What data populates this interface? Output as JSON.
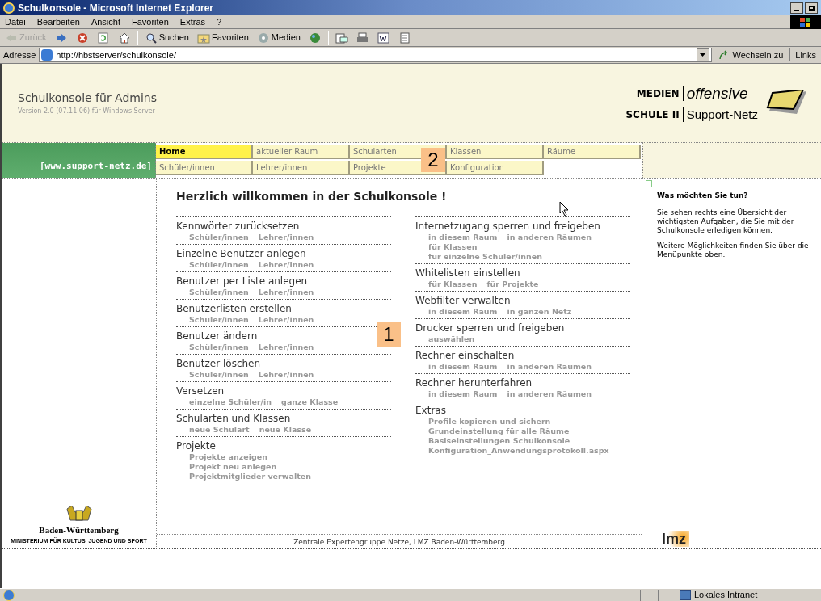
{
  "window": {
    "title": "Schulkonsole - Microsoft Internet Explorer"
  },
  "menu": [
    "Datei",
    "Bearbeiten",
    "Ansicht",
    "Favoriten",
    "Extras",
    "?"
  ],
  "toolbar": [
    {
      "kind": "back",
      "label": "Zurück",
      "disabled": true
    },
    {
      "kind": "forward",
      "disabled": false
    },
    {
      "kind": "stop"
    },
    {
      "kind": "refresh"
    },
    {
      "kind": "home"
    },
    {
      "kind": "sep"
    },
    {
      "kind": "search",
      "label": "Suchen"
    },
    {
      "kind": "favorites",
      "label": "Favoriten"
    },
    {
      "kind": "media",
      "label": "Medien"
    },
    {
      "kind": "history"
    },
    {
      "kind": "sep"
    },
    {
      "kind": "mail"
    },
    {
      "kind": "print"
    },
    {
      "kind": "word"
    },
    {
      "kind": "note"
    }
  ],
  "address": {
    "label": "Adresse",
    "value": "http://hbstserver/schulkonsole/",
    "go": "Wechseln zu",
    "links": "Links"
  },
  "header": {
    "title": "Schulkonsole für Admins",
    "version": "Version 2.0 (07.11.06) für Windows Server",
    "logo_top_left": "MEDIEN",
    "logo_top_right": "offensive",
    "logo_bottom_left": "SCHULE II",
    "logo_bottom_right": "Support-Netz"
  },
  "banner": "[www.support-netz.de]",
  "nav": [
    [
      {
        "label": "Home",
        "selected": true
      },
      {
        "label": "aktueller Raum",
        "selected": false
      },
      {
        "label": "Schularten",
        "selected": false
      },
      {
        "label": "Klassen",
        "selected": false
      },
      {
        "label": "Räume",
        "selected": false
      }
    ],
    [
      {
        "label": "Schüler/innen",
        "selected": false
      },
      {
        "label": "Lehrer/innen",
        "selected": false
      },
      {
        "label": "Projekte",
        "selected": false
      },
      {
        "label": "Konfiguration",
        "selected": false
      }
    ]
  ],
  "welcome": "Herzlich willkommen in der Schulkonsole !",
  "columns": [
    [
      {
        "title": "Kennwörter zurücksetzen",
        "links": [
          [
            "Schüler/innen",
            "Lehrer/innen"
          ]
        ]
      },
      {
        "title": "Einzelne Benutzer anlegen",
        "links": [
          [
            "Schüler/innen",
            "Lehrer/innen"
          ]
        ]
      },
      {
        "title": "Benutzer per Liste anlegen",
        "links": [
          [
            "Schüler/innen",
            "Lehrer/innen"
          ]
        ]
      },
      {
        "title": "Benutzerlisten erstellen",
        "links": [
          [
            "Schüler/innen",
            "Lehrer/innen"
          ]
        ]
      },
      {
        "title": "Benutzer ändern",
        "links": [
          [
            "Schüler/innen",
            "Lehrer/innen"
          ]
        ]
      },
      {
        "title": "Benutzer löschen",
        "links": [
          [
            "Schüler/innen",
            "Lehrer/innen"
          ]
        ]
      },
      {
        "title": "Versetzen",
        "links": [
          [
            "einzelne Schüler/in",
            "ganze Klasse"
          ]
        ]
      },
      {
        "title": "Schularten und Klassen",
        "links": [
          [
            "neue Schulart",
            "neue Klasse"
          ]
        ]
      },
      {
        "title": "Projekte",
        "links": [
          [
            "Projekte anzeigen"
          ],
          [
            "Projekt neu anlegen"
          ],
          [
            "Projektmitglieder verwalten"
          ]
        ]
      }
    ],
    [
      {
        "title": "Internetzugang sperren und freigeben",
        "links": [
          [
            "in diesem Raum",
            "in anderen Räumen"
          ],
          [
            "für Klassen"
          ],
          [
            "für einzelne Schüler/innen"
          ]
        ]
      },
      {
        "title": "Whitelisten einstellen",
        "links": [
          [
            "für Klassen",
            "für Projekte"
          ]
        ]
      },
      {
        "title": "Webfilter verwalten",
        "links": [
          [
            "in diesem Raum",
            "in ganzen Netz"
          ]
        ]
      },
      {
        "title": "Drucker sperren und freigeben",
        "links": [
          [
            "auswählen"
          ]
        ]
      },
      {
        "title": "Rechner einschalten",
        "links": [
          [
            "in diesem Raum",
            "in anderen Räumen"
          ]
        ]
      },
      {
        "title": "Rechner herunterfahren",
        "links": [
          [
            "in diesem Raum",
            "in anderen Räumen"
          ]
        ]
      },
      {
        "title": "Extras",
        "links": [
          [
            "Profile kopieren und sichern"
          ],
          [
            "Grundeinstellung für alle Räume"
          ],
          [
            "Basiseinstellungen Schulkonsole"
          ],
          [
            "Konfiguration_Anwendungsprotokoll.aspx"
          ]
        ]
      }
    ]
  ],
  "sidebar": {
    "title": "Was möchten Sie tun?",
    "paragraphs": [
      "Sie sehen rechts eine Übersicht der wichtigsten Aufgaben, die Sie mit der Schulkonsole erledigen können.",
      "Weitere Möglichkeiten finden Sie über die Menüpunkte oben."
    ]
  },
  "left_logo": {
    "name": "Baden-Württemberg",
    "sub": "MINISTERIUM FÜR KULTUS, JUGEND UND SPORT"
  },
  "right_logo": "lmz",
  "footer": "Zentrale Expertengruppe Netze, LMZ Baden-Württemberg",
  "callouts": [
    "1",
    "2"
  ],
  "status_bar": {
    "zone": "Lokales Intranet"
  }
}
